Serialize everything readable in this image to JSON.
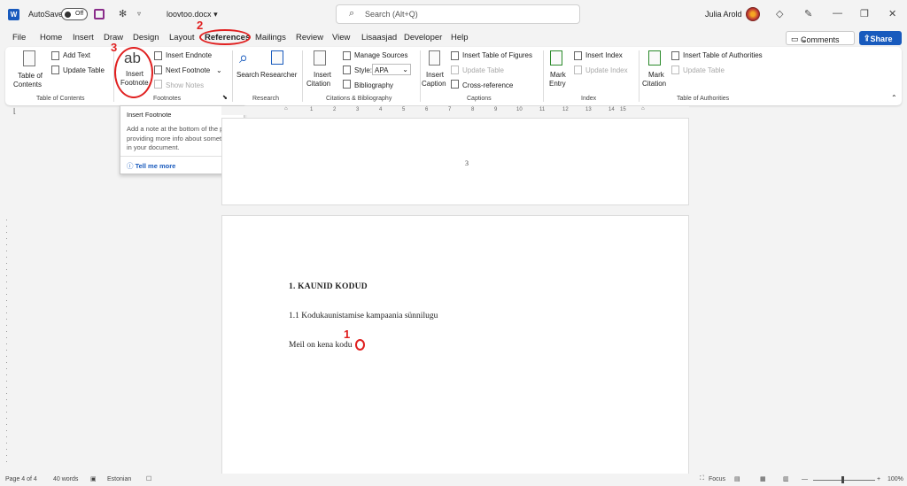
{
  "titlebar": {
    "autosave_label": "AutoSave",
    "autosave_state": "Off",
    "filename": "loovtoo.docx",
    "filename_caret": "▾",
    "search_placeholder": "Search (Alt+Q)",
    "user_name": "Julia Arold"
  },
  "menu": {
    "tabs": [
      "File",
      "Home",
      "Insert",
      "Draw",
      "Design",
      "Layout",
      "References",
      "Mailings",
      "Review",
      "View",
      "Lisaasjad",
      "Developer",
      "Help"
    ],
    "active_tab": "References",
    "comments_label": "Comments",
    "share_label": "Share"
  },
  "ribbon": {
    "toc": {
      "big_label_1": "Table of",
      "big_label_2": "Contents",
      "add_text": "Add Text",
      "update_table": "Update Table",
      "group": "Table of Contents"
    },
    "footnotes": {
      "big_icon_text": "ab",
      "big_label_1": "Insert",
      "big_label_2": "Footnote",
      "insert_endnote": "Insert Endnote",
      "next_footnote": "Next Footnote",
      "show_notes": "Show Notes",
      "group": "Footnotes"
    },
    "research": {
      "search": "Search",
      "researcher": "Researcher",
      "group": "Research"
    },
    "citations": {
      "insert_citation_1": "Insert",
      "insert_citation_2": "Citation",
      "manage_sources": "Manage Sources",
      "style_label": "Style:",
      "style_value": "APA",
      "bibliography": "Bibliography",
      "group": "Citations & Bibliography"
    },
    "captions": {
      "insert_caption_1": "Insert",
      "insert_caption_2": "Caption",
      "insert_table_of_figures": "Insert Table of Figures",
      "update_table": "Update Table",
      "cross_reference": "Cross-reference",
      "group": "Captions"
    },
    "index": {
      "mark_entry_1": "Mark",
      "mark_entry_2": "Entry",
      "insert_index": "Insert Index",
      "update_index": "Update Index",
      "group": "Index"
    },
    "authorities": {
      "mark_citation_1": "Mark",
      "mark_citation_2": "Citation",
      "insert_table_of_authorities": "Insert Table of Authorities",
      "update_table": "Update Table",
      "group": "Table of Authorities"
    }
  },
  "tooltip": {
    "title": "Insert Footnote",
    "description": "Add a note at the bottom of the page providing more info about something in your document.",
    "link": "Tell me more"
  },
  "annotations": {
    "step1": "1",
    "step2": "2",
    "step3": "3"
  },
  "ruler": {
    "marks": [
      "1",
      "2",
      "3",
      "4",
      "5",
      "6",
      "7",
      "8",
      "9",
      "10",
      "11",
      "12",
      "13",
      "14",
      "15"
    ]
  },
  "document": {
    "page_number": "3",
    "heading": "1.   KAUNID KODUD",
    "subheading": "1.1 Kodukaunistamise kampaania sünnilugu",
    "paragraph": "Meil on kena kodu"
  },
  "status": {
    "page": "Page 4 of 4",
    "words": "40 words",
    "language": "Estonian",
    "focus": "Focus",
    "zoom": "100%"
  },
  "colors": {
    "accent": "#185abd",
    "annotation": "#e02020"
  }
}
